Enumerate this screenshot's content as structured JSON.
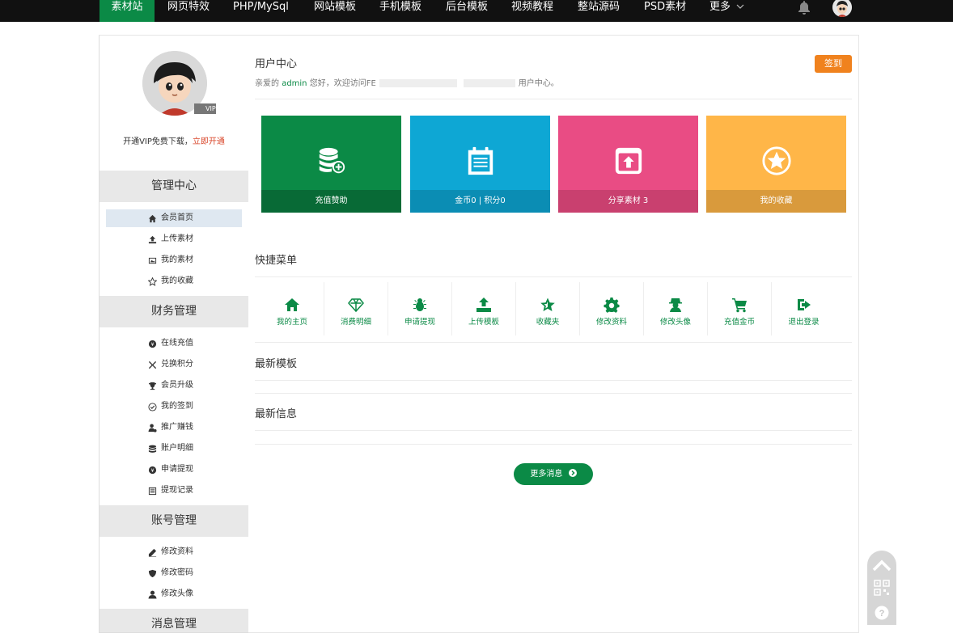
{
  "nav": {
    "items": [
      {
        "label": "素材站",
        "active": true
      },
      {
        "label": "网页特效"
      },
      {
        "label": "PHP/MySql"
      },
      {
        "label": "网站模板"
      },
      {
        "label": "手机模板"
      },
      {
        "label": "后台模板"
      },
      {
        "label": "视频教程"
      },
      {
        "label": "整站源码"
      },
      {
        "label": "PSD素材"
      },
      {
        "label": "更多"
      }
    ],
    "more_chevron": "chevron-down-icon",
    "bell_icon": "bell-icon",
    "avatar_icon": "user-avatar"
  },
  "sidebar": {
    "vip_badge": "VIP",
    "vip_text": "开通VIP免费下载，",
    "vip_link": "立即开通",
    "sections": [
      {
        "title": "管理中心",
        "items": [
          {
            "label": "会员首页",
            "icon": "home-icon",
            "active": true
          },
          {
            "label": "上传素材",
            "icon": "upload-icon"
          },
          {
            "label": "我的素材",
            "icon": "image-icon"
          },
          {
            "label": "我的收藏",
            "icon": "star-icon"
          }
        ]
      },
      {
        "title": "财务管理",
        "items": [
          {
            "label": "在线充值",
            "icon": "coin-icon"
          },
          {
            "label": "兑换积分",
            "icon": "exchange-icon"
          },
          {
            "label": "会员升级",
            "icon": "trophy-icon"
          },
          {
            "label": "我的签到",
            "icon": "check-circle-icon"
          },
          {
            "label": "推广赚钱",
            "icon": "user-money-icon"
          },
          {
            "label": "账户明细",
            "icon": "database-icon"
          },
          {
            "label": "申请提现",
            "icon": "yen-icon"
          },
          {
            "label": "提现记录",
            "icon": "list-icon"
          }
        ]
      },
      {
        "title": "账号管理",
        "items": [
          {
            "label": "修改资料",
            "icon": "edit-icon"
          },
          {
            "label": "修改密码",
            "icon": "shield-icon"
          },
          {
            "label": "修改头像",
            "icon": "user-icon"
          }
        ]
      },
      {
        "title": "消息管理",
        "items": []
      }
    ]
  },
  "main": {
    "title": "用户中心",
    "welcome_prefix": "亲爱的",
    "username": "admin",
    "welcome_mid": "您好，欢迎访问FE",
    "welcome_suffix": "用户中心。",
    "sign_label": "签到",
    "tiles": [
      {
        "label": "充值赞助",
        "icon": "database-plus-icon",
        "color": "#0b8a46",
        "caption_color": "#086a36"
      },
      {
        "label": "金币0 | 积分0",
        "icon": "calendar-list-icon",
        "color": "#0ea7d4",
        "caption_color": "#0b8db4"
      },
      {
        "label": "分享素材 3",
        "icon": "share-upload-icon",
        "color": "#e94c84",
        "caption_color": "#c9406f"
      },
      {
        "label": "我的收藏",
        "icon": "star-circle-icon",
        "color": "#ffb648",
        "caption_color": "#d99a3c"
      }
    ],
    "quick_title": "快捷菜单",
    "quick": [
      {
        "label": "我的主页",
        "icon": "home-icon"
      },
      {
        "label": "消费明细",
        "icon": "diamond-icon"
      },
      {
        "label": "申请提现",
        "icon": "bug-icon"
      },
      {
        "label": "上传模板",
        "icon": "upload-icon"
      },
      {
        "label": "收藏夹",
        "icon": "star-icon"
      },
      {
        "label": "修改资料",
        "icon": "gear-icon"
      },
      {
        "label": "修改头像",
        "icon": "user-secret-icon"
      },
      {
        "label": "充值金币",
        "icon": "cart-icon"
      },
      {
        "label": "退出登录",
        "icon": "logout-icon"
      }
    ],
    "latest_templates": "最新模板",
    "latest_info": "最新信息",
    "more_label": "更多消息"
  },
  "float": {
    "top_icon": "chevron-up-icon",
    "qr_icon": "qr-code-icon",
    "help_icon": "help-icon"
  }
}
